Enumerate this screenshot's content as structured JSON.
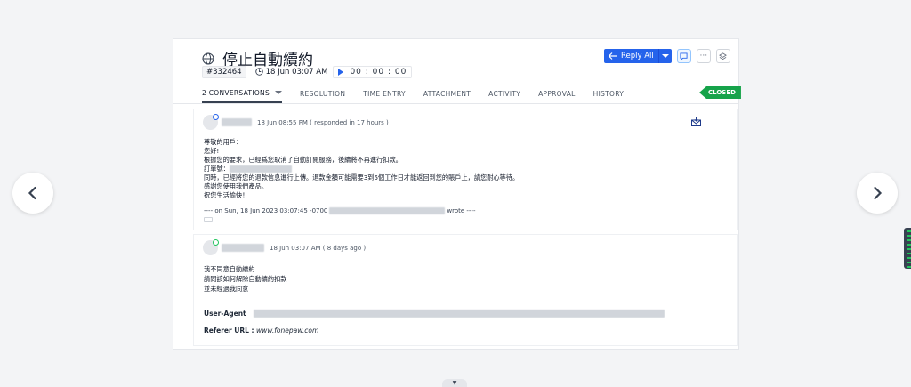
{
  "ticket": {
    "title": "停止自動續約",
    "id": "#332464",
    "created": "18 Jun 03:07 AM",
    "timer": "00 : 00 : 00",
    "status": "CLOSED"
  },
  "toolbar": {
    "reply_all_label": "Reply All",
    "icons": [
      "reply-icon",
      "chat-icon",
      "more-icon",
      "layers-icon"
    ]
  },
  "tabs": [
    {
      "label": "2 CONVERSATIONS"
    },
    {
      "label": "RESOLUTION"
    },
    {
      "label": "TIME ENTRY"
    },
    {
      "label": "ATTACHMENT"
    },
    {
      "label": "ACTIVITY"
    },
    {
      "label": "APPROVAL"
    },
    {
      "label": "HISTORY"
    }
  ],
  "conversations": [
    {
      "timestamp": "18 Jun 08:55 PM ( responded in 17 hours )",
      "lines": [
        "尊敬的用戶：",
        "您好!",
        "根據您的要求，已經爲您取消了自動訂閱服務，後續將不再進行扣款。",
        "訂單號：",
        "同時，已經將您的退款信息進行上傳。退款金額可能需要3到5個工作日才能返回到您的賬戶上，請您耐心等待。",
        "感謝您使用我們產品。",
        "祝您生活愉快！"
      ],
      "quote_prefix": "---- on Sun, 18 Jun 2023 03:07:45 -0700",
      "quote_suffix": "wrote ----"
    },
    {
      "timestamp": "18 Jun 03:07 AM ( 8 days ago )",
      "lines": [
        "我不同意自動續約",
        "請問該如何解除自動續約扣款",
        "並未經過我同意"
      ],
      "user_agent_label": "User-Agent",
      "referer_label": "Referer URL :",
      "referer_value": "www.fonepaw.com"
    }
  ],
  "colors": {
    "primary": "#2563eb",
    "closed": "#16a34a"
  }
}
